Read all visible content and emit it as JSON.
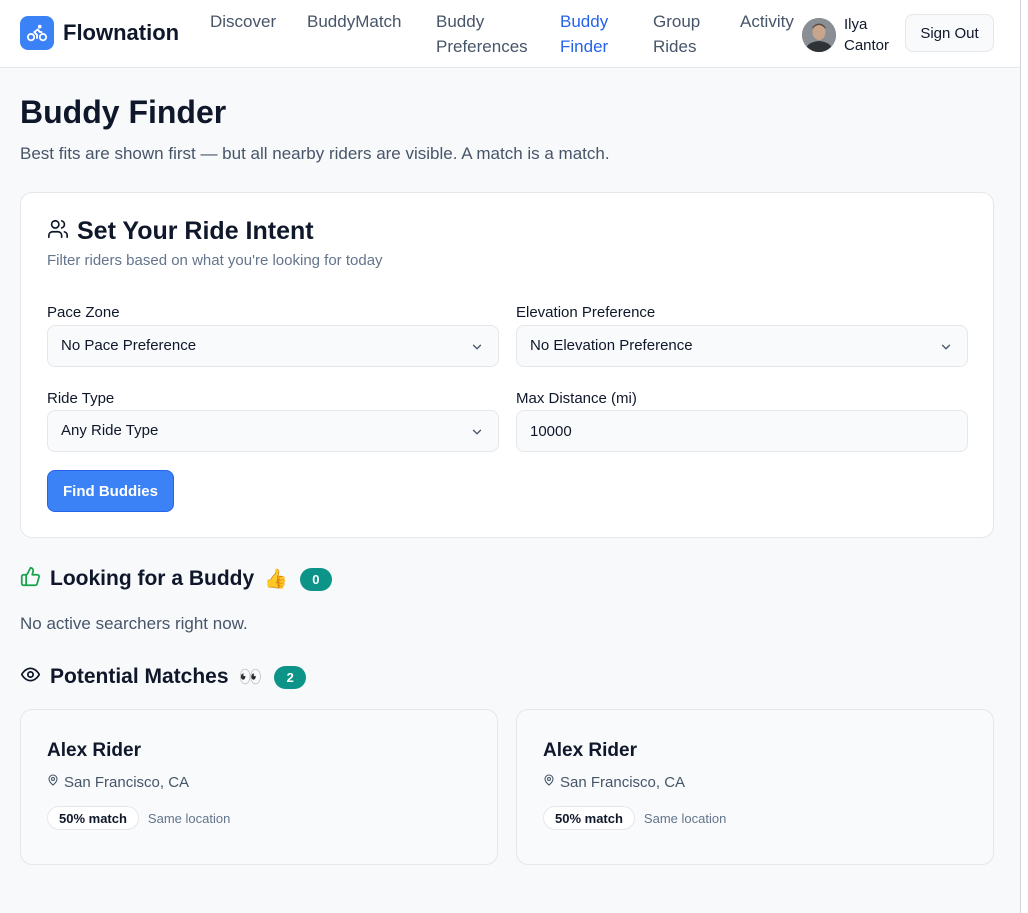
{
  "brand": {
    "name": "Flownation",
    "logo_icon": "bike-icon",
    "accent": "#3b82f6"
  },
  "nav": {
    "links": [
      {
        "label": "Discover",
        "active": false
      },
      {
        "label": "BuddyMatch",
        "active": false
      },
      {
        "label": "Buddy Preferences",
        "active": false
      },
      {
        "label": "Buddy Finder",
        "active": true
      },
      {
        "label": "Group Rides",
        "active": false
      },
      {
        "label": "Activity",
        "active": false
      }
    ],
    "user_name": "Ilya Cantor",
    "sign_out": "Sign Out"
  },
  "page": {
    "title": "Buddy Finder",
    "subtitle": "Best fits are shown first — but all nearby riders are visible. A match is a match."
  },
  "intent": {
    "title": "Set Your Ride Intent",
    "subtitle": "Filter riders based on what you're looking for today",
    "pace_label": "Pace Zone",
    "pace_value": "No Pace Preference",
    "elevation_label": "Elevation Preference",
    "elevation_value": "No Elevation Preference",
    "ride_type_label": "Ride Type",
    "ride_type_value": "Any Ride Type",
    "distance_label": "Max Distance (mi)",
    "distance_value": "10000",
    "find_button": "Find Buddies"
  },
  "looking": {
    "title": "Looking for a Buddy",
    "emoji": "👍",
    "count": "0",
    "empty_message": "No active searchers right now."
  },
  "potential": {
    "title": "Potential Matches",
    "emoji": "👀",
    "count": "2",
    "matches": [
      {
        "name": "Alex Rider",
        "location": "San Francisco, CA",
        "match": "50% match",
        "reason": "Same location"
      },
      {
        "name": "Alex Rider",
        "location": "San Francisco, CA",
        "match": "50% match",
        "reason": "Same location"
      }
    ]
  },
  "colors": {
    "active_link": "#2563eb",
    "badge": "#0d9488",
    "thumbs_icon": "#16a34a"
  }
}
